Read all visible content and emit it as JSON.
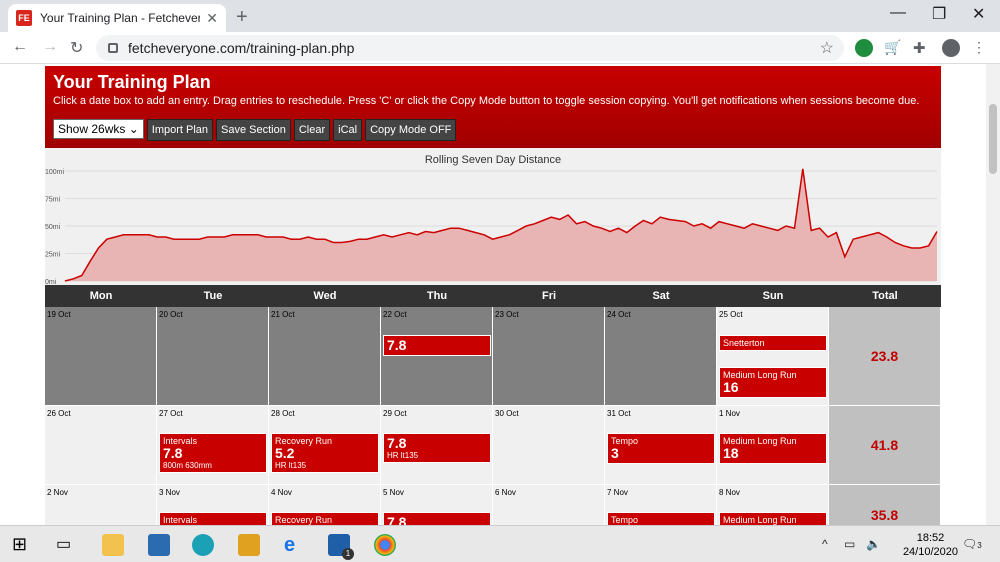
{
  "browser": {
    "tab_title": "Your Training Plan - Fetcheveryon",
    "url": "fetcheveryone.com/training-plan.php",
    "favicon": "FE"
  },
  "header": {
    "title": "Your Training Plan",
    "instructions": "Click a date box to add an entry. Drag entries to reschedule. Press 'C' or click the Copy Mode button to toggle session copying. You'll get notifications when sessions become due.",
    "select_value": "Show 26wks",
    "buttons": [
      "Import Plan",
      "Save Section",
      "Clear",
      "iCal",
      "Copy Mode OFF"
    ]
  },
  "chart_data": {
    "type": "area",
    "title": "Rolling Seven Day Distance",
    "ylabel": "",
    "y_ticks": [
      "100mi",
      "75mi",
      "50mi",
      "25mi",
      "0mi"
    ],
    "ylim": [
      0,
      100
    ],
    "values": [
      0,
      2,
      5,
      18,
      30,
      38,
      40,
      42,
      42,
      42,
      42,
      40,
      40,
      38,
      38,
      38,
      38,
      40,
      40,
      40,
      42,
      42,
      42,
      42,
      40,
      40,
      40,
      38,
      38,
      40,
      38,
      38,
      35,
      35,
      36,
      38,
      38,
      40,
      42,
      40,
      42,
      44,
      42,
      45,
      44,
      46,
      48,
      48,
      46,
      44,
      42,
      38,
      40,
      42,
      46,
      50,
      52,
      55,
      58,
      56,
      60,
      52,
      54,
      50,
      48,
      45,
      48,
      44,
      50,
      55,
      52,
      58,
      56,
      55,
      54,
      50,
      52,
      48,
      54,
      52,
      50,
      48,
      52,
      50,
      48,
      46,
      50,
      48,
      102,
      46,
      48,
      40,
      44,
      22,
      38,
      40,
      42,
      44,
      40,
      35,
      32,
      30,
      30,
      32,
      45
    ],
    "fill_color": "#e8b4b4",
    "line_color": "#cc0000"
  },
  "weekdays": [
    "Mon",
    "Tue",
    "Wed",
    "Thu",
    "Fri",
    "Sat",
    "Sun",
    "Total"
  ],
  "weeks": [
    {
      "dates": [
        "19 Oct",
        "20 Oct",
        "21 Oct",
        "22 Oct",
        "23 Oct",
        "24 Oct",
        "25 Oct"
      ],
      "total": "23.8",
      "entries": [
        {
          "day": 3,
          "top": 28,
          "title": "",
          "value": "7.8",
          "note": ""
        },
        {
          "day": 6,
          "top": 28,
          "title": "Snetterton",
          "value": "",
          "note": ""
        },
        {
          "day": 6,
          "top": 60,
          "title": "Medium Long Run",
          "value": "16",
          "note": ""
        }
      ]
    },
    {
      "dates": [
        "26 Oct",
        "27 Oct",
        "28 Oct",
        "29 Oct",
        "30 Oct",
        "31 Oct",
        "1 Nov"
      ],
      "total": "41.8",
      "entries": [
        {
          "day": 1,
          "top": 27,
          "title": "Intervals",
          "value": "7.8",
          "note": "800m 630mm"
        },
        {
          "day": 2,
          "top": 27,
          "title": "Recovery Run",
          "value": "5.2",
          "note": "HR lt135"
        },
        {
          "day": 3,
          "top": 27,
          "title": "",
          "value": "7.8",
          "note": "HR lt135"
        },
        {
          "day": 5,
          "top": 27,
          "title": "Tempo",
          "value": "3",
          "note": ""
        },
        {
          "day": 6,
          "top": 27,
          "title": "Medium Long Run",
          "value": "18",
          "note": ""
        }
      ]
    },
    {
      "dates": [
        "2 Nov",
        "3 Nov",
        "4 Nov",
        "5 Nov",
        "6 Nov",
        "7 Nov",
        "8 Nov"
      ],
      "total": "35.8",
      "entries": [
        {
          "day": 1,
          "top": 27,
          "title": "Intervals",
          "value": "",
          "note": ""
        },
        {
          "day": 2,
          "top": 27,
          "title": "Recovery Run",
          "value": "",
          "note": ""
        },
        {
          "day": 3,
          "top": 27,
          "title": "",
          "value": "7.8",
          "note": ""
        },
        {
          "day": 5,
          "top": 27,
          "title": "Tempo",
          "value": "",
          "note": ""
        },
        {
          "day": 6,
          "top": 27,
          "title": "Medium Long Run",
          "value": "",
          "note": ""
        }
      ]
    }
  ],
  "taskbar": {
    "time": "18:52",
    "date": "24/10/2020",
    "notifications": "3",
    "mail_badge": "1"
  }
}
